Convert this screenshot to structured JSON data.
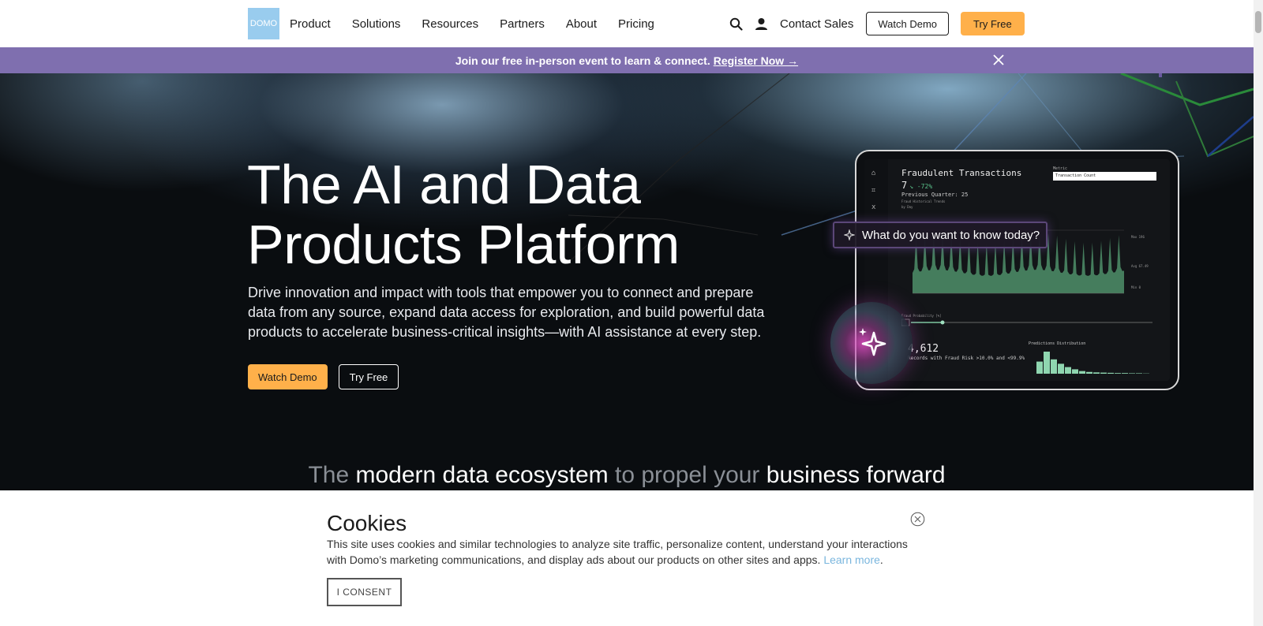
{
  "nav": {
    "logo_text": "DOMO",
    "links": [
      "Product",
      "Solutions",
      "Resources",
      "Partners",
      "About",
      "Pricing"
    ],
    "contact_label": "Contact Sales",
    "watch_demo_label": "Watch Demo",
    "try_free_label": "Try Free"
  },
  "banner": {
    "text": "Join our free in-person event to learn & connect.",
    "link_text": "Register Now →"
  },
  "hero": {
    "title_line1": "The AI and Data",
    "title_line2": "Products Platform",
    "subtitle": "Drive innovation and impact with tools that empower you to connect and prepare data from any source, expand data access for exploration, and build powerful data products to accelerate business-critical insights—with AI assistance at every step.",
    "watch_demo_label": "Watch Demo",
    "try_free_label": "Try Free"
  },
  "dashboard": {
    "title": "Fraudulent Transactions",
    "value": "7",
    "change": "↘ -72%",
    "previous": "Previous Quarter: 25",
    "trend_label": "Fraud Historical Trends",
    "by_day": "by Day",
    "metric_label": "Metric",
    "metric_select": "Transaction Count",
    "max_label": "Max 196",
    "avg_label": "Avg 67.49",
    "min_label": "Min 0",
    "probability_label": "Fraud Probability [%]",
    "records_value": "4,612",
    "records_label": "Records with Fraud Risk >10.0% and <99.9%",
    "predictions_label": "Predictions Distribution",
    "ask_prompt": "What do you want to know today?"
  },
  "ecosystem": {
    "part1": "The",
    "part2": "modern data ecosystem",
    "part3": "to propel your",
    "part4": "business forward"
  },
  "cookies": {
    "title": "Cookies",
    "text": "This site uses cookies and similar technologies to analyze site traffic, personalize content, understand your interactions with Domo’s marketing communications, and display ads about our products on other sites and apps.",
    "learn_more": "Learn more",
    "consent_label": "I CONSENT"
  },
  "colors": {
    "accent_orange": "#ffb04a",
    "banner_purple": "#7f6faf",
    "logo_blue": "#99ccee",
    "chart_green": "#4f8f6a"
  }
}
